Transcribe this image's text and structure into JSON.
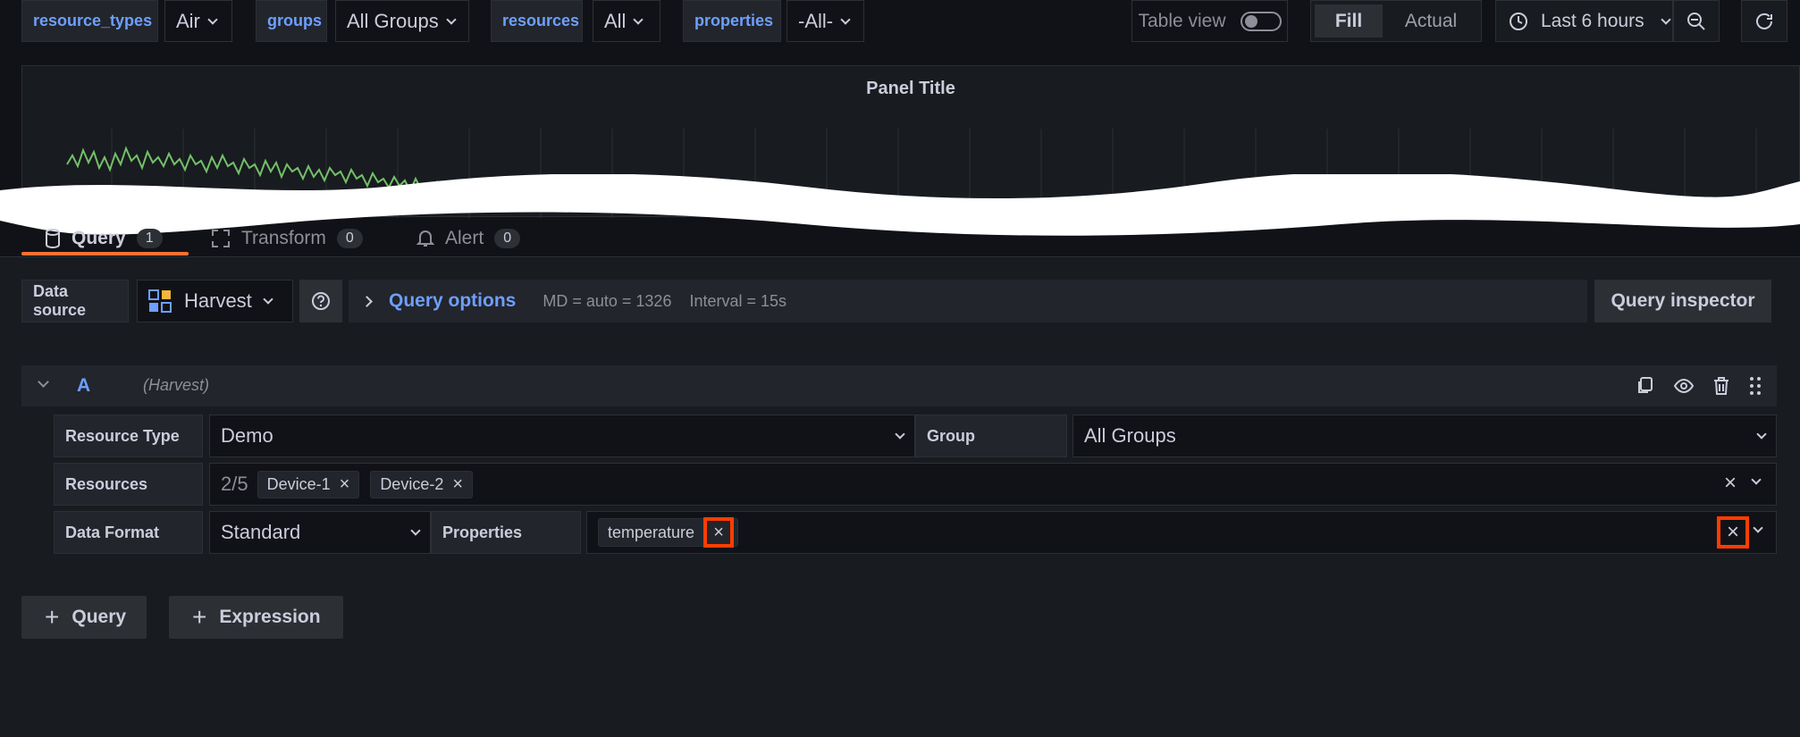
{
  "variables": [
    {
      "label": "resource_types",
      "value": "Air"
    },
    {
      "label": "groups",
      "value": "All Groups"
    },
    {
      "label": "resources",
      "value": "All"
    },
    {
      "label": "properties",
      "value": "-All-"
    }
  ],
  "toolbar": {
    "table_view_label": "Table view",
    "fill_label": "Fill",
    "actual_label": "Actual",
    "time_range": "Last 6 hours"
  },
  "panel": {
    "title": "Panel Title"
  },
  "tabs": [
    {
      "label": "Query",
      "count": "1"
    },
    {
      "label": "Transform",
      "count": "0"
    },
    {
      "label": "Alert",
      "count": "0"
    }
  ],
  "datasource": {
    "label": "Data source",
    "value": "Harvest",
    "query_options_label": "Query options",
    "md": "MD = auto = 1326",
    "interval": "Interval = 15s",
    "inspector_label": "Query inspector"
  },
  "query": {
    "ref": "A",
    "source": "(Harvest)",
    "resource_type_label": "Resource Type",
    "resource_type_value": "Demo",
    "group_label": "Group",
    "group_value": "All Groups",
    "resources_label": "Resources",
    "resources_count": "2/5",
    "resources": [
      "Device-1",
      "Device-2"
    ],
    "data_format_label": "Data Format",
    "data_format_value": "Standard",
    "properties_label": "Properties",
    "properties": [
      "temperature"
    ]
  },
  "buttons": {
    "add_query": "Query",
    "add_expression": "Expression"
  },
  "colors": {
    "accent": "#6e9fff",
    "highlight": "#ff3d00",
    "tab_active": "#ff7033",
    "series": "#73bf69"
  }
}
